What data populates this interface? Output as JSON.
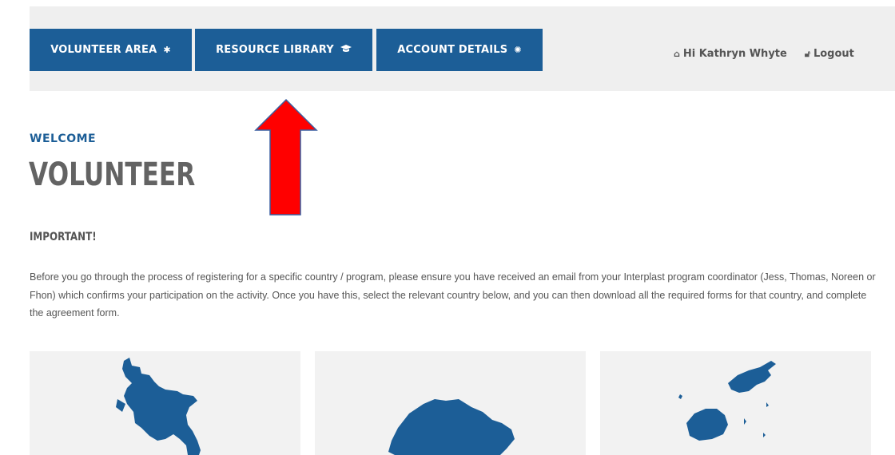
{
  "nav": {
    "buttons": [
      {
        "label": "VOLUNTEER AREA",
        "icon": "asterisk-icon"
      },
      {
        "label": "RESOURCE LIBRARY",
        "icon": "graduation-cap-icon"
      },
      {
        "label": "ACCOUNT DETAILS",
        "icon": "gear-icon"
      }
    ],
    "greeting": "Hi Kathryn Whyte",
    "logout": "Logout"
  },
  "header": {
    "welcome": "WELCOME",
    "title": "VOLUNTEER"
  },
  "notice": {
    "heading": "IMPORTANT!",
    "text": "Before you go through the process of registering for a specific country / program, please ensure you have received an email from your Interplast program coordinator (Jess, Thomas, Noreen or Fhon) which confirms your participation on the activity. Once you have this, select the relevant country below, and you can then download all the required forms for that country, and complete the agreement form."
  },
  "colors": {
    "brand": "#1c5e97",
    "nav_bg": "#efefef",
    "card_bg": "#f2f2f2",
    "arrow": "#ff0000"
  }
}
